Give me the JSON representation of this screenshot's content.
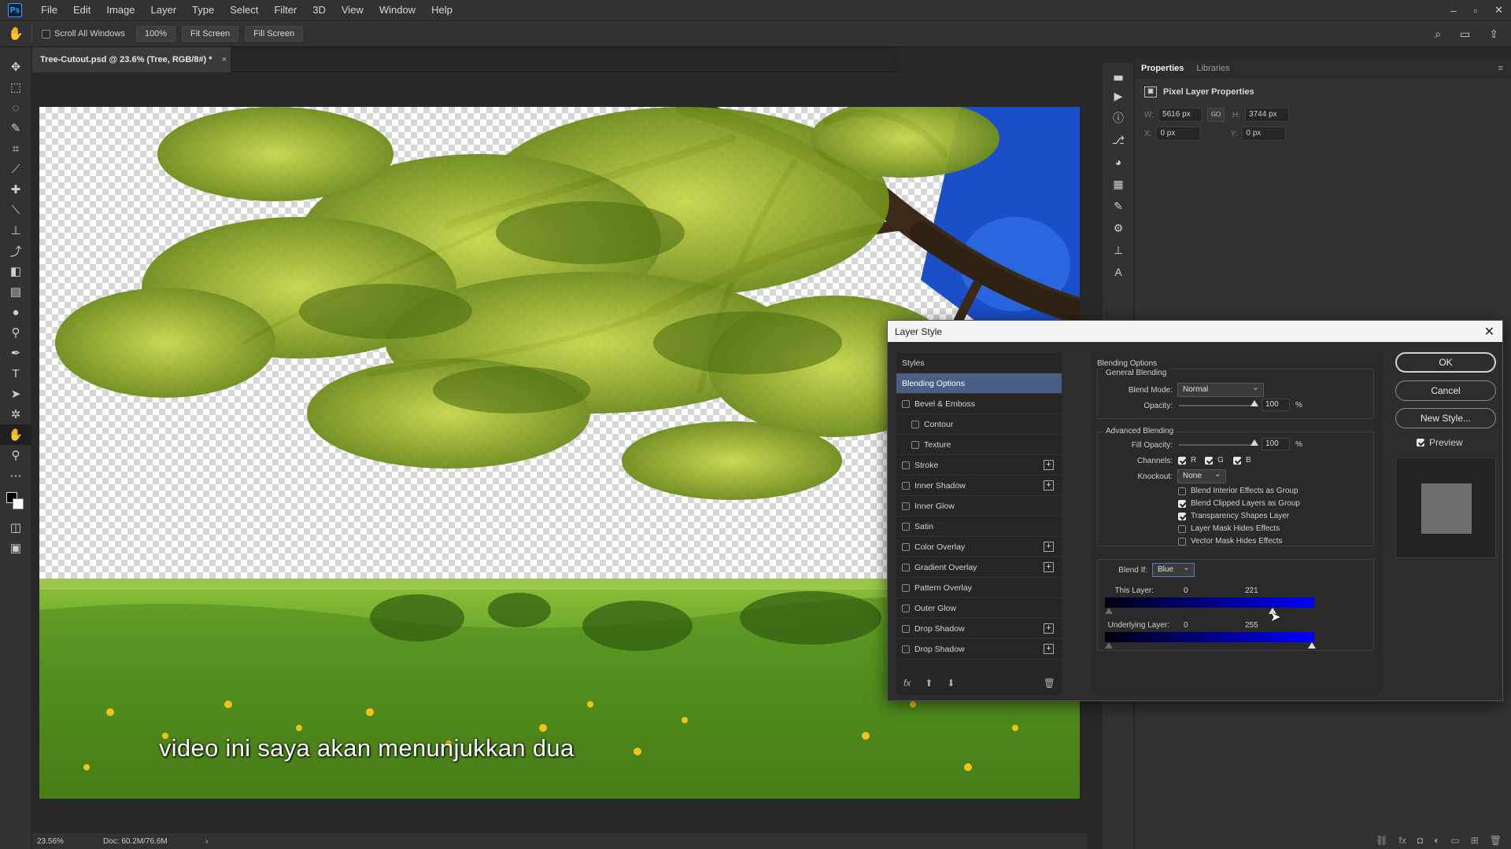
{
  "menubar": {
    "logo": "Ps",
    "items": [
      "File",
      "Edit",
      "Image",
      "Layer",
      "Type",
      "Select",
      "Filter",
      "3D",
      "View",
      "Window",
      "Help"
    ],
    "window_controls": [
      "–",
      "▫",
      "✕"
    ]
  },
  "options": {
    "scroll_all_windows": "Scroll All Windows",
    "zoom": "100%",
    "fit_screen": "Fit Screen",
    "fill_screen": "Fill Screen"
  },
  "document": {
    "tab_title": "Tree-Cutout.psd @ 23.6% (Tree, RGB/8#) *",
    "close": "×",
    "subtitle": "video ini saya akan menunjukkan dua"
  },
  "status": {
    "zoom": "23.56%",
    "doc": "Doc: 60.2M/76.6M",
    "arrow": "›"
  },
  "properties": {
    "tabs": [
      "Properties",
      "Libraries"
    ],
    "title": "Pixel Layer Properties",
    "w_label": "W:",
    "w_value": "5616 px",
    "h_label": "H:",
    "h_value": "3744 px",
    "x_label": "X:",
    "x_value": "0 px",
    "y_label": "Y:",
    "y_value": "0 px",
    "link": "GO"
  },
  "dialog": {
    "title": "Layer Style",
    "close": "✕",
    "styles_header": "Styles",
    "styles": [
      {
        "label": "Blending Options",
        "checkbox": false,
        "plus": false,
        "active": true,
        "indent": false
      },
      {
        "label": "Bevel & Emboss",
        "checkbox": true,
        "plus": false,
        "active": false,
        "indent": false
      },
      {
        "label": "Contour",
        "checkbox": true,
        "plus": false,
        "active": false,
        "indent": true
      },
      {
        "label": "Texture",
        "checkbox": true,
        "plus": false,
        "active": false,
        "indent": true
      },
      {
        "label": "Stroke",
        "checkbox": true,
        "plus": true,
        "active": false,
        "indent": false
      },
      {
        "label": "Inner Shadow",
        "checkbox": true,
        "plus": true,
        "active": false,
        "indent": false
      },
      {
        "label": "Inner Glow",
        "checkbox": true,
        "plus": false,
        "active": false,
        "indent": false
      },
      {
        "label": "Satin",
        "checkbox": true,
        "plus": false,
        "active": false,
        "indent": false
      },
      {
        "label": "Color Overlay",
        "checkbox": true,
        "plus": true,
        "active": false,
        "indent": false
      },
      {
        "label": "Gradient Overlay",
        "checkbox": true,
        "plus": true,
        "active": false,
        "indent": false
      },
      {
        "label": "Pattern Overlay",
        "checkbox": true,
        "plus": false,
        "active": false,
        "indent": false
      },
      {
        "label": "Outer Glow",
        "checkbox": true,
        "plus": false,
        "active": false,
        "indent": false
      },
      {
        "label": "Drop Shadow",
        "checkbox": true,
        "plus": true,
        "active": false,
        "indent": false
      },
      {
        "label": "Drop Shadow",
        "checkbox": true,
        "plus": true,
        "active": false,
        "indent": false
      }
    ],
    "footer": {
      "fx": "fx",
      "up": "⬆",
      "down": "⬇",
      "trash": "🗑"
    },
    "blending": {
      "section": "Blending Options",
      "general": "General Blending",
      "blend_mode_label": "Blend Mode:",
      "blend_mode": "Normal",
      "opacity_label": "Opacity:",
      "opacity": "100",
      "percent": "%",
      "advanced": "Advanced Blending",
      "fill_opacity_label": "Fill Opacity:",
      "fill_opacity": "100",
      "channels_label": "Channels:",
      "channel_r": "R",
      "channel_g": "G",
      "channel_b": "B",
      "knockout_label": "Knockout:",
      "knockout": "None",
      "opt_interior": "Blend Interior Effects as Group",
      "opt_clipped": "Blend Clipped Layers as Group",
      "opt_transparency": "Transparency Shapes Layer",
      "opt_layer_mask": "Layer Mask Hides Effects",
      "opt_vector_mask": "Vector Mask Hides Effects",
      "blend_if_label": "Blend If:",
      "blend_if": "Blue",
      "this_layer_label": "This Layer:",
      "this_layer_min": "0",
      "this_layer_max": "221",
      "underlying_label": "Underlying Layer:",
      "underlying_min": "0",
      "underlying_max": "255"
    },
    "buttons": {
      "ok": "OK",
      "cancel": "Cancel",
      "new_style": "New Style...",
      "preview": "Preview"
    }
  }
}
